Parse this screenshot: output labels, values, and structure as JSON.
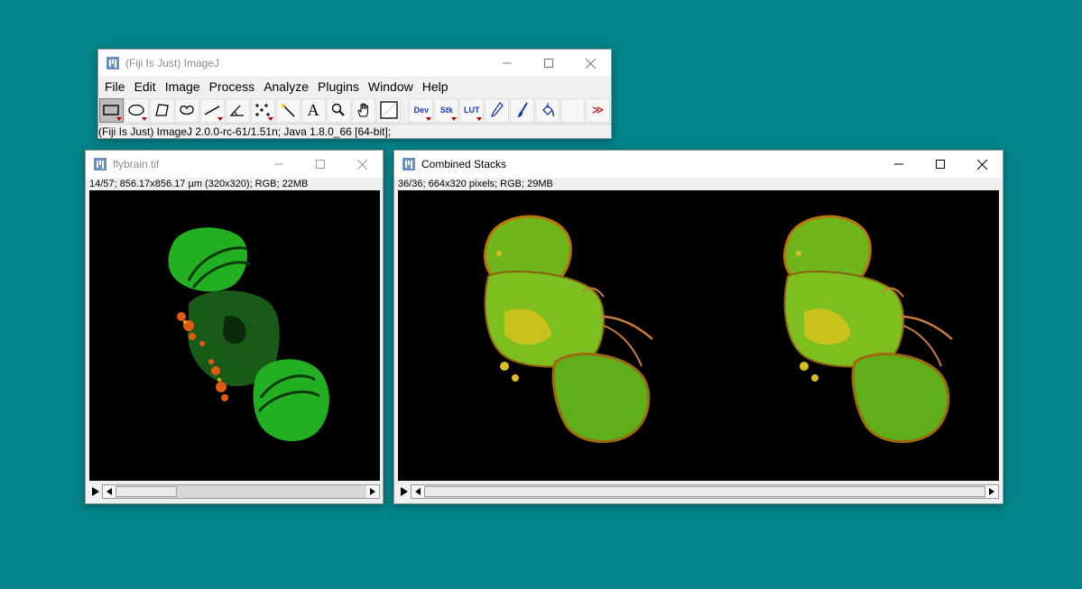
{
  "desktop": {
    "background": "#03848a"
  },
  "main_window": {
    "title": "(Fiji Is Just) ImageJ",
    "menu": [
      "File",
      "Edit",
      "Image",
      "Process",
      "Analyze",
      "Plugins",
      "Window",
      "Help"
    ],
    "tools": {
      "rectangle": "rectangle-selection-icon",
      "oval": "oval-selection-icon",
      "polygon": "polygon-selection-icon",
      "freehand": "freehand-selection-icon",
      "line": "line-selection-icon",
      "angle": "angle-tool-icon",
      "point": "multipoint-tool-icon",
      "wand": "wand-tool-icon",
      "text": "A",
      "zoom": "magnifier-icon",
      "hand": "hand-tool-icon",
      "color": "color-picker-icon",
      "dev": "Dev",
      "stk": "Stk",
      "lut": "LUT",
      "pencil": "pencil-icon",
      "brush": "brush-icon",
      "flood": "flood-fill-icon",
      "more": "≫"
    },
    "status": "(Fiji Is Just) ImageJ 2.0.0-rc-61/1.51n; Java 1.8.0_66 [64-bit];"
  },
  "flybrain_window": {
    "title": "flybrain.tif",
    "info": "14/57; 856.17x856.17 µm (320x320); RGB; 22MB",
    "slice_position": 0.24
  },
  "combined_window": {
    "title": "Combined Stacks",
    "info": "36/36; 664x320 pixels; RGB; 29MB",
    "slice_position": 1.0
  }
}
